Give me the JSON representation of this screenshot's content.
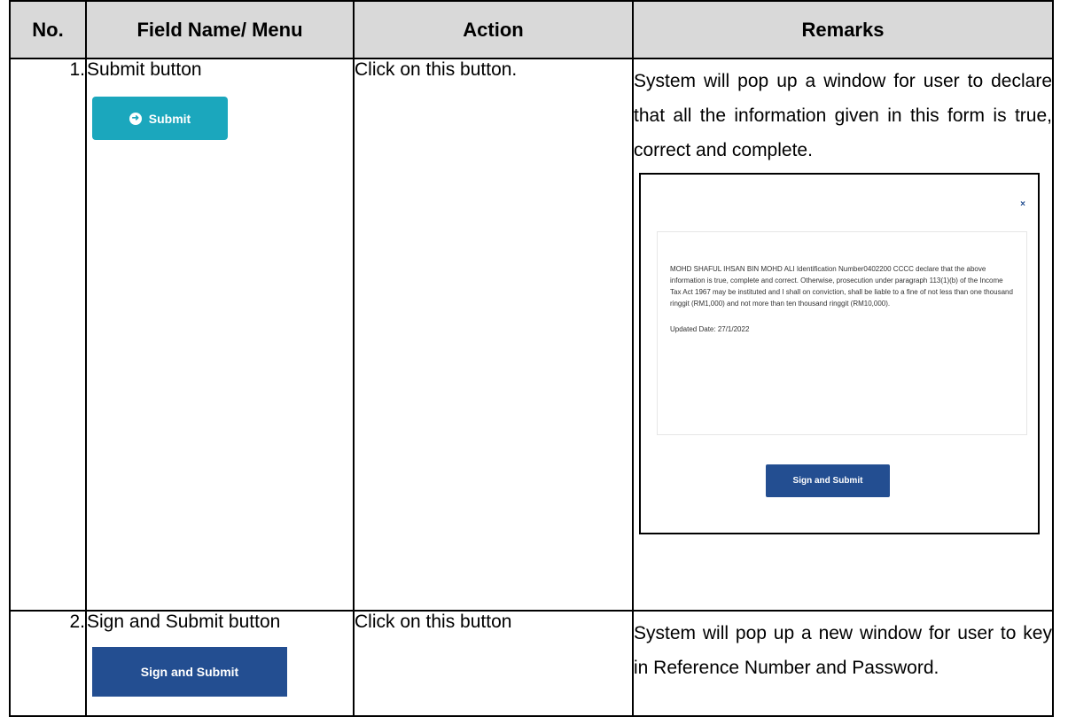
{
  "headers": [
    "No.",
    "Field Name/ Menu",
    "Action",
    "Remarks"
  ],
  "rows": [
    {
      "no": "1.",
      "field": "Submit button",
      "button_label": "Submit",
      "action": "Click on this button.",
      "remarks": "System will pop up a window for user to declare that all the information given in this form is true, correct and complete.",
      "popup": {
        "close": "×",
        "declaration": "MOHD SHAFUL IHSAN BIN MOHD ALI Identification Number0402200 CCCC declare that the above information is true, complete and correct. Otherwise, prosecution under paragraph 113(1)(b) of the Income Tax Act 1967 may be instituted and I shall on conviction, shall be liable to a fine of not less than one thousand ringgit (RM1,000) and not more than ten thousand ringgit (RM10,000).",
        "updated": "Updated Date: 27/1/2022",
        "button": "Sign and Submit"
      }
    },
    {
      "no": "2.",
      "field": "Sign and Submit button",
      "button_label": "Sign and Submit",
      "action": "Click on this button",
      "remarks": "System will pop up a new window for user to key in Reference Number and Password."
    }
  ]
}
